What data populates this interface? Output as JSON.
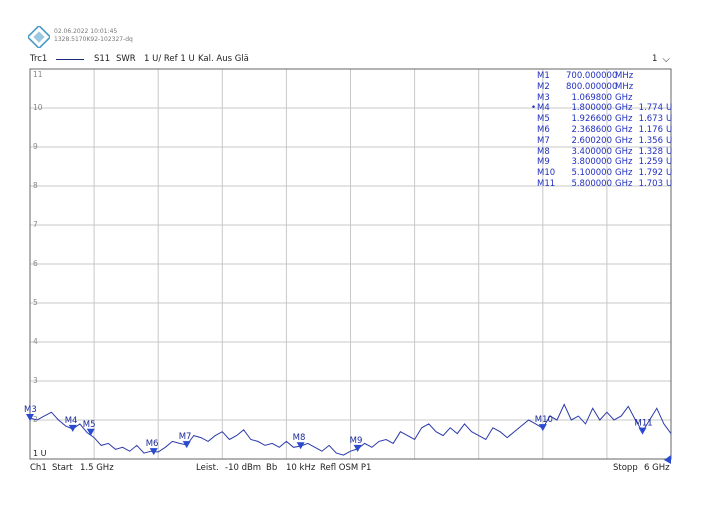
{
  "header": {
    "timestamp": "02.06.2022 10:01:45",
    "file_id": "1328.5170K92-102327-dq"
  },
  "topbar": {
    "trace": "Trc1",
    "param": "S11",
    "format": "SWR",
    "scale": "1 U/ Ref 1 U",
    "cal": "Kal. Aus Glä",
    "channel_selector": "1",
    "chevron": "chevron-down-icon"
  },
  "footer": {
    "channel": "Ch1",
    "start_label": "Start",
    "start_value": "1.5 GHz",
    "power_label": "Leist.",
    "power_value": "-10 dBm",
    "bw_label": "Bb",
    "bw_value": "10 kHz",
    "port": "Refl OSM P1",
    "stop_label": "Stopp",
    "stop_value": "6 GHz"
  },
  "markers_table": [
    {
      "name": "M1",
      "freq": "700.000000",
      "unit": "MHz",
      "value": "",
      "vunit": "",
      "active": false
    },
    {
      "name": "M2",
      "freq": "800.000000",
      "unit": "MHz",
      "value": "",
      "vunit": "",
      "active": false
    },
    {
      "name": "M3",
      "freq": "1.069800",
      "unit": "GHz",
      "value": "",
      "vunit": "",
      "active": false
    },
    {
      "name": "M4",
      "freq": "1.800000",
      "unit": "GHz",
      "value": "1.774",
      "vunit": "U",
      "active": true
    },
    {
      "name": "M5",
      "freq": "1.926600",
      "unit": "GHz",
      "value": "1.673",
      "vunit": "U",
      "active": false
    },
    {
      "name": "M6",
      "freq": "2.368600",
      "unit": "GHz",
      "value": "1.176",
      "vunit": "U",
      "active": false
    },
    {
      "name": "M7",
      "freq": "2.600200",
      "unit": "GHz",
      "value": "1.356",
      "vunit": "U",
      "active": false
    },
    {
      "name": "M8",
      "freq": "3.400000",
      "unit": "GHz",
      "value": "1.328",
      "vunit": "U",
      "active": false
    },
    {
      "name": "M9",
      "freq": "3.800000",
      "unit": "GHz",
      "value": "1.259",
      "vunit": "U",
      "active": false
    },
    {
      "name": "M10",
      "freq": "5.100000",
      "unit": "GHz",
      "value": "1.792",
      "vunit": "U",
      "active": false
    },
    {
      "name": "M11",
      "freq": "5.800000",
      "unit": "GHz",
      "value": "1.703",
      "vunit": "U",
      "active": false
    }
  ],
  "colors": {
    "trace": "#2a3aa8",
    "marker": "#2a4ad0",
    "grid": "#c8c8c8",
    "frame": "#666666"
  },
  "chart_data": {
    "type": "line",
    "xlim": [
      1.5,
      6.0
    ],
    "ylim": [
      1,
      11
    ],
    "yticks": [
      "11",
      "10",
      "9",
      "8",
      "7",
      "6",
      "5",
      "4",
      "3",
      "2"
    ],
    "ref_label": "1 U",
    "grid": true,
    "markers_on_trace": [
      {
        "label": "M3",
        "x": 1.5,
        "y": 2.05
      },
      {
        "label": "M4",
        "x": 1.8,
        "y": 1.774
      },
      {
        "label": "M5",
        "x": 1.9266,
        "y": 1.673
      },
      {
        "label": "M6",
        "x": 2.3686,
        "y": 1.176
      },
      {
        "label": "M7",
        "x": 2.6002,
        "y": 1.356
      },
      {
        "label": "M8",
        "x": 3.4,
        "y": 1.328
      },
      {
        "label": "M9",
        "x": 3.8,
        "y": 1.259
      },
      {
        "label": "M10",
        "x": 5.1,
        "y": 1.792
      },
      {
        "label": "M11",
        "x": 5.8,
        "y": 1.703
      }
    ],
    "x": [
      1.5,
      1.55,
      1.6,
      1.65,
      1.7,
      1.75,
      1.8,
      1.85,
      1.9,
      1.95,
      2.0,
      2.05,
      2.1,
      2.15,
      2.2,
      2.25,
      2.3,
      2.35,
      2.4,
      2.45,
      2.5,
      2.55,
      2.6,
      2.65,
      2.7,
      2.75,
      2.8,
      2.85,
      2.9,
      2.95,
      3.0,
      3.05,
      3.1,
      3.15,
      3.2,
      3.25,
      3.3,
      3.35,
      3.4,
      3.45,
      3.5,
      3.55,
      3.6,
      3.65,
      3.7,
      3.75,
      3.8,
      3.85,
      3.9,
      3.95,
      4.0,
      4.05,
      4.1,
      4.15,
      4.2,
      4.25,
      4.3,
      4.35,
      4.4,
      4.45,
      4.5,
      4.55,
      4.6,
      4.65,
      4.7,
      4.75,
      4.8,
      4.85,
      4.9,
      4.95,
      5.0,
      5.05,
      5.1,
      5.15,
      5.2,
      5.25,
      5.3,
      5.35,
      5.4,
      5.45,
      5.5,
      5.55,
      5.6,
      5.65,
      5.7,
      5.75,
      5.8,
      5.85,
      5.9,
      5.95,
      6.0
    ],
    "y": [
      2.05,
      2.0,
      2.1,
      2.2,
      2.0,
      1.85,
      1.77,
      1.9,
      1.68,
      1.55,
      1.35,
      1.4,
      1.25,
      1.3,
      1.2,
      1.35,
      1.15,
      1.2,
      1.18,
      1.3,
      1.45,
      1.4,
      1.36,
      1.6,
      1.55,
      1.45,
      1.6,
      1.7,
      1.5,
      1.6,
      1.75,
      1.5,
      1.45,
      1.35,
      1.4,
      1.3,
      1.45,
      1.3,
      1.33,
      1.4,
      1.3,
      1.2,
      1.35,
      1.15,
      1.1,
      1.2,
      1.26,
      1.4,
      1.3,
      1.45,
      1.5,
      1.4,
      1.7,
      1.6,
      1.5,
      1.8,
      1.9,
      1.7,
      1.6,
      1.8,
      1.65,
      1.9,
      1.7,
      1.6,
      1.5,
      1.8,
      1.7,
      1.55,
      1.7,
      1.85,
      2.0,
      1.9,
      1.79,
      2.1,
      2.0,
      2.4,
      2.0,
      2.1,
      1.9,
      2.3,
      2.0,
      2.2,
      2.0,
      2.1,
      2.35,
      2.0,
      1.7,
      2.0,
      2.3,
      1.9,
      1.65
    ]
  }
}
